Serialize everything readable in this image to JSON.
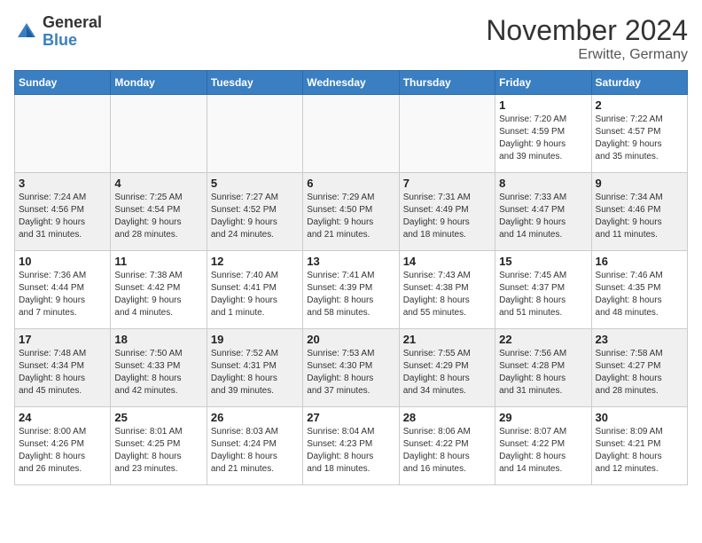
{
  "logo": {
    "general": "General",
    "blue": "Blue"
  },
  "title": "November 2024",
  "location": "Erwitte, Germany",
  "days_of_week": [
    "Sunday",
    "Monday",
    "Tuesday",
    "Wednesday",
    "Thursday",
    "Friday",
    "Saturday"
  ],
  "weeks": [
    [
      {
        "day": "",
        "info": "",
        "empty": true
      },
      {
        "day": "",
        "info": "",
        "empty": true
      },
      {
        "day": "",
        "info": "",
        "empty": true
      },
      {
        "day": "",
        "info": "",
        "empty": true
      },
      {
        "day": "",
        "info": "",
        "empty": true
      },
      {
        "day": "1",
        "info": "Sunrise: 7:20 AM\nSunset: 4:59 PM\nDaylight: 9 hours\nand 39 minutes."
      },
      {
        "day": "2",
        "info": "Sunrise: 7:22 AM\nSunset: 4:57 PM\nDaylight: 9 hours\nand 35 minutes."
      }
    ],
    [
      {
        "day": "3",
        "info": "Sunrise: 7:24 AM\nSunset: 4:56 PM\nDaylight: 9 hours\nand 31 minutes."
      },
      {
        "day": "4",
        "info": "Sunrise: 7:25 AM\nSunset: 4:54 PM\nDaylight: 9 hours\nand 28 minutes."
      },
      {
        "day": "5",
        "info": "Sunrise: 7:27 AM\nSunset: 4:52 PM\nDaylight: 9 hours\nand 24 minutes."
      },
      {
        "day": "6",
        "info": "Sunrise: 7:29 AM\nSunset: 4:50 PM\nDaylight: 9 hours\nand 21 minutes."
      },
      {
        "day": "7",
        "info": "Sunrise: 7:31 AM\nSunset: 4:49 PM\nDaylight: 9 hours\nand 18 minutes."
      },
      {
        "day": "8",
        "info": "Sunrise: 7:33 AM\nSunset: 4:47 PM\nDaylight: 9 hours\nand 14 minutes."
      },
      {
        "day": "9",
        "info": "Sunrise: 7:34 AM\nSunset: 4:46 PM\nDaylight: 9 hours\nand 11 minutes."
      }
    ],
    [
      {
        "day": "10",
        "info": "Sunrise: 7:36 AM\nSunset: 4:44 PM\nDaylight: 9 hours\nand 7 minutes."
      },
      {
        "day": "11",
        "info": "Sunrise: 7:38 AM\nSunset: 4:42 PM\nDaylight: 9 hours\nand 4 minutes."
      },
      {
        "day": "12",
        "info": "Sunrise: 7:40 AM\nSunset: 4:41 PM\nDaylight: 9 hours\nand 1 minute."
      },
      {
        "day": "13",
        "info": "Sunrise: 7:41 AM\nSunset: 4:39 PM\nDaylight: 8 hours\nand 58 minutes."
      },
      {
        "day": "14",
        "info": "Sunrise: 7:43 AM\nSunset: 4:38 PM\nDaylight: 8 hours\nand 55 minutes."
      },
      {
        "day": "15",
        "info": "Sunrise: 7:45 AM\nSunset: 4:37 PM\nDaylight: 8 hours\nand 51 minutes."
      },
      {
        "day": "16",
        "info": "Sunrise: 7:46 AM\nSunset: 4:35 PM\nDaylight: 8 hours\nand 48 minutes."
      }
    ],
    [
      {
        "day": "17",
        "info": "Sunrise: 7:48 AM\nSunset: 4:34 PM\nDaylight: 8 hours\nand 45 minutes."
      },
      {
        "day": "18",
        "info": "Sunrise: 7:50 AM\nSunset: 4:33 PM\nDaylight: 8 hours\nand 42 minutes."
      },
      {
        "day": "19",
        "info": "Sunrise: 7:52 AM\nSunset: 4:31 PM\nDaylight: 8 hours\nand 39 minutes."
      },
      {
        "day": "20",
        "info": "Sunrise: 7:53 AM\nSunset: 4:30 PM\nDaylight: 8 hours\nand 37 minutes."
      },
      {
        "day": "21",
        "info": "Sunrise: 7:55 AM\nSunset: 4:29 PM\nDaylight: 8 hours\nand 34 minutes."
      },
      {
        "day": "22",
        "info": "Sunrise: 7:56 AM\nSunset: 4:28 PM\nDaylight: 8 hours\nand 31 minutes."
      },
      {
        "day": "23",
        "info": "Sunrise: 7:58 AM\nSunset: 4:27 PM\nDaylight: 8 hours\nand 28 minutes."
      }
    ],
    [
      {
        "day": "24",
        "info": "Sunrise: 8:00 AM\nSunset: 4:26 PM\nDaylight: 8 hours\nand 26 minutes."
      },
      {
        "day": "25",
        "info": "Sunrise: 8:01 AM\nSunset: 4:25 PM\nDaylight: 8 hours\nand 23 minutes."
      },
      {
        "day": "26",
        "info": "Sunrise: 8:03 AM\nSunset: 4:24 PM\nDaylight: 8 hours\nand 21 minutes."
      },
      {
        "day": "27",
        "info": "Sunrise: 8:04 AM\nSunset: 4:23 PM\nDaylight: 8 hours\nand 18 minutes."
      },
      {
        "day": "28",
        "info": "Sunrise: 8:06 AM\nSunset: 4:22 PM\nDaylight: 8 hours\nand 16 minutes."
      },
      {
        "day": "29",
        "info": "Sunrise: 8:07 AM\nSunset: 4:22 PM\nDaylight: 8 hours\nand 14 minutes."
      },
      {
        "day": "30",
        "info": "Sunrise: 8:09 AM\nSunset: 4:21 PM\nDaylight: 8 hours\nand 12 minutes."
      }
    ]
  ]
}
